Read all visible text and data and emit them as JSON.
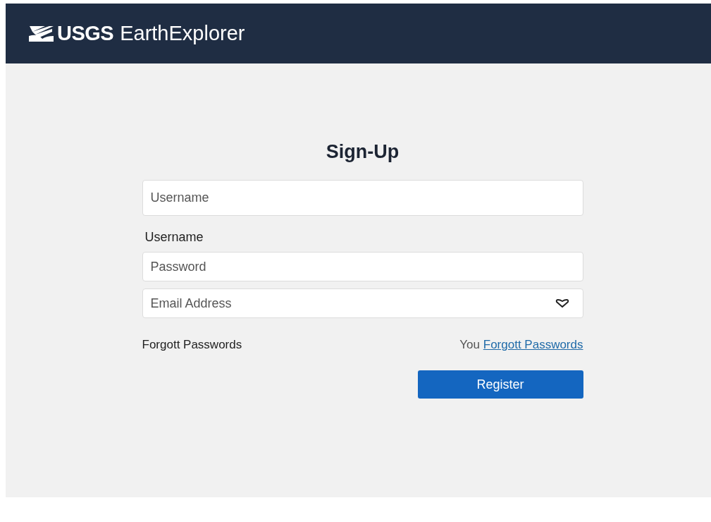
{
  "header": {
    "logo_mark": "USGS",
    "app_name": "EarthExplorer"
  },
  "form": {
    "title": "Sign-Up",
    "items": [
      {
        "kind": "field",
        "placeholder": "Username",
        "has_icon": false
      },
      {
        "kind": "label",
        "text": "Username"
      },
      {
        "kind": "field",
        "placeholder": "Password",
        "has_icon": false
      },
      {
        "kind": "field",
        "placeholder": "Email Address",
        "has_icon": true
      }
    ],
    "left_link": "Forgott Passwords",
    "right_prefix": "You",
    "right_link": "Forgott Passwords",
    "submit": "Register"
  }
}
